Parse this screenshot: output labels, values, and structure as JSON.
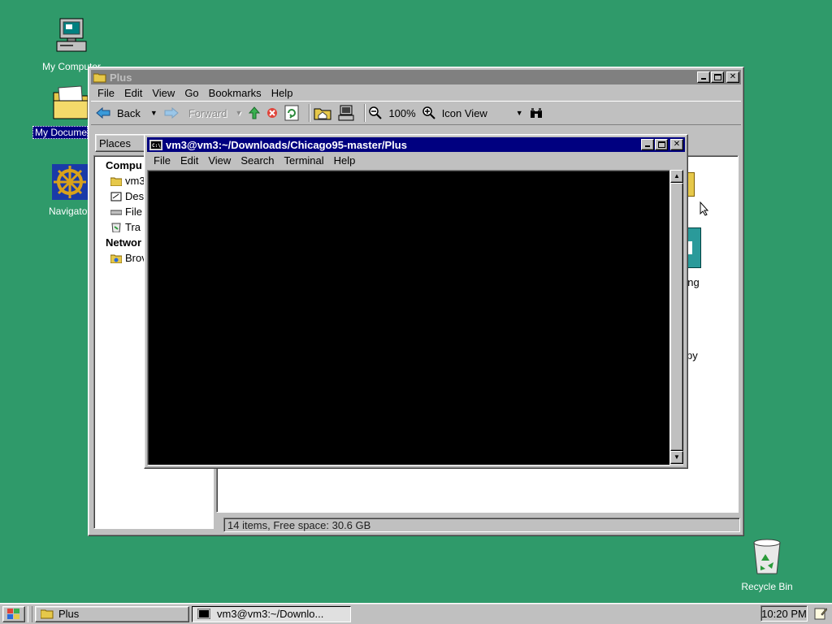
{
  "desktop": {
    "icons": [
      {
        "label": "My Computer"
      },
      {
        "label": "My Documents"
      },
      {
        "label": "Navigator"
      },
      {
        "label": "Recycle Bin"
      }
    ]
  },
  "file_manager": {
    "title": "Plus",
    "menu": [
      "File",
      "Edit",
      "View",
      "Go",
      "Bookmarks",
      "Help"
    ],
    "toolbar": {
      "back": "Back",
      "forward": "Forward",
      "zoom": "100%",
      "view_mode": "Icon View"
    },
    "sidebar": {
      "header": "Places",
      "sections": [
        {
          "title": "Compu",
          "items": [
            "vm3",
            "Des",
            "File",
            "Tra"
          ]
        },
        {
          "title": "Networ",
          "items": [
            "Brov"
          ]
        }
      ]
    },
    "partial_labels": [
      "ong",
      "py"
    ],
    "status": "14 items, Free space: 30.6 GB"
  },
  "terminal": {
    "title": "vm3@vm3:~/Downloads/Chicago95-master/Plus",
    "menu": [
      "File",
      "Edit",
      "View",
      "Search",
      "Terminal",
      "Help"
    ]
  },
  "taskbar": {
    "tasks": [
      {
        "label": "Plus"
      },
      {
        "label": "vm3@vm3:~/Downlo..."
      }
    ],
    "clock": "10:20 PM"
  },
  "colors": {
    "desktop": "#2f9a6a",
    "active_title": "#000080",
    "inactive_title": "#808080",
    "face": "#c0c0c0"
  }
}
